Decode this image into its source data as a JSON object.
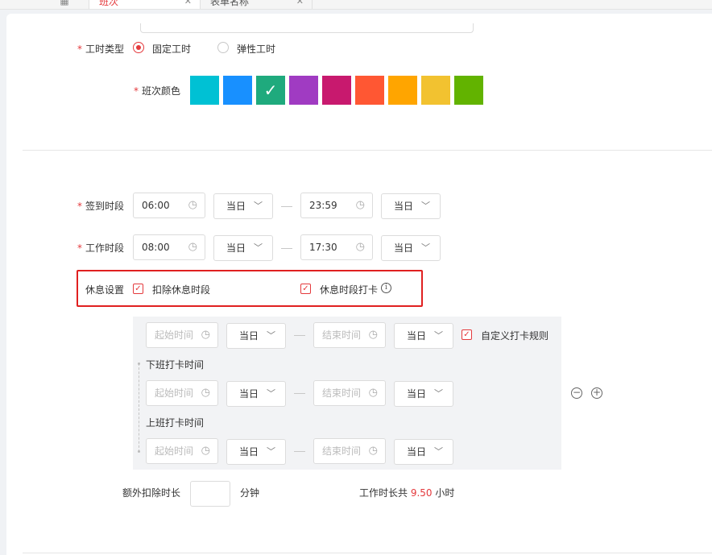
{
  "tabs": [
    {
      "label": "班次",
      "close": "✕"
    },
    {
      "label": "表单名称",
      "close": "✕"
    }
  ],
  "form": {
    "work_type": {
      "label": "工时类型",
      "options": [
        {
          "label": "固定工时",
          "selected": true
        },
        {
          "label": "弹性工时",
          "selected": false
        }
      ]
    },
    "shift_color": {
      "label": "班次颜色",
      "colors": [
        "#00c1d4",
        "#1890ff",
        "#1faa7d",
        "#a03bc2",
        "#c8196e",
        "#ff5733",
        "#ffa500",
        "#f2c230",
        "#62b300"
      ],
      "selected_index": 2
    },
    "checkin_period": {
      "label": "签到时段",
      "start": "06:00",
      "start_day": "当日",
      "end": "23:59",
      "end_day": "当日"
    },
    "work_period": {
      "label": "工作时段",
      "start": "08:00",
      "start_day": "当日",
      "end": "17:30",
      "end_day": "当日"
    },
    "rest_setting": {
      "label": "休息设置",
      "deduct_label": "扣除休息时段",
      "deduct_checked": true,
      "punch_label": "休息时段打卡",
      "punch_checked": true
    },
    "rest_panel": {
      "start_placeholder": "起始时间",
      "end_placeholder": "结束时间",
      "day": "当日",
      "custom_rule_label": "自定义打卡规则",
      "custom_rule_checked": true,
      "off_punch_label": "下班打卡时间",
      "on_punch_label": "上班打卡时间"
    },
    "extra_deduct": {
      "label": "额外扣除时长",
      "unit": "分钟"
    },
    "total": {
      "prefix": "工作时长共",
      "value": "9.50",
      "unit": "小时"
    }
  },
  "required_mark": "*",
  "icons": {
    "clock": "◷",
    "chevron": "﹀",
    "check": "✓",
    "info": "i",
    "minus": "−",
    "plus": "+"
  }
}
